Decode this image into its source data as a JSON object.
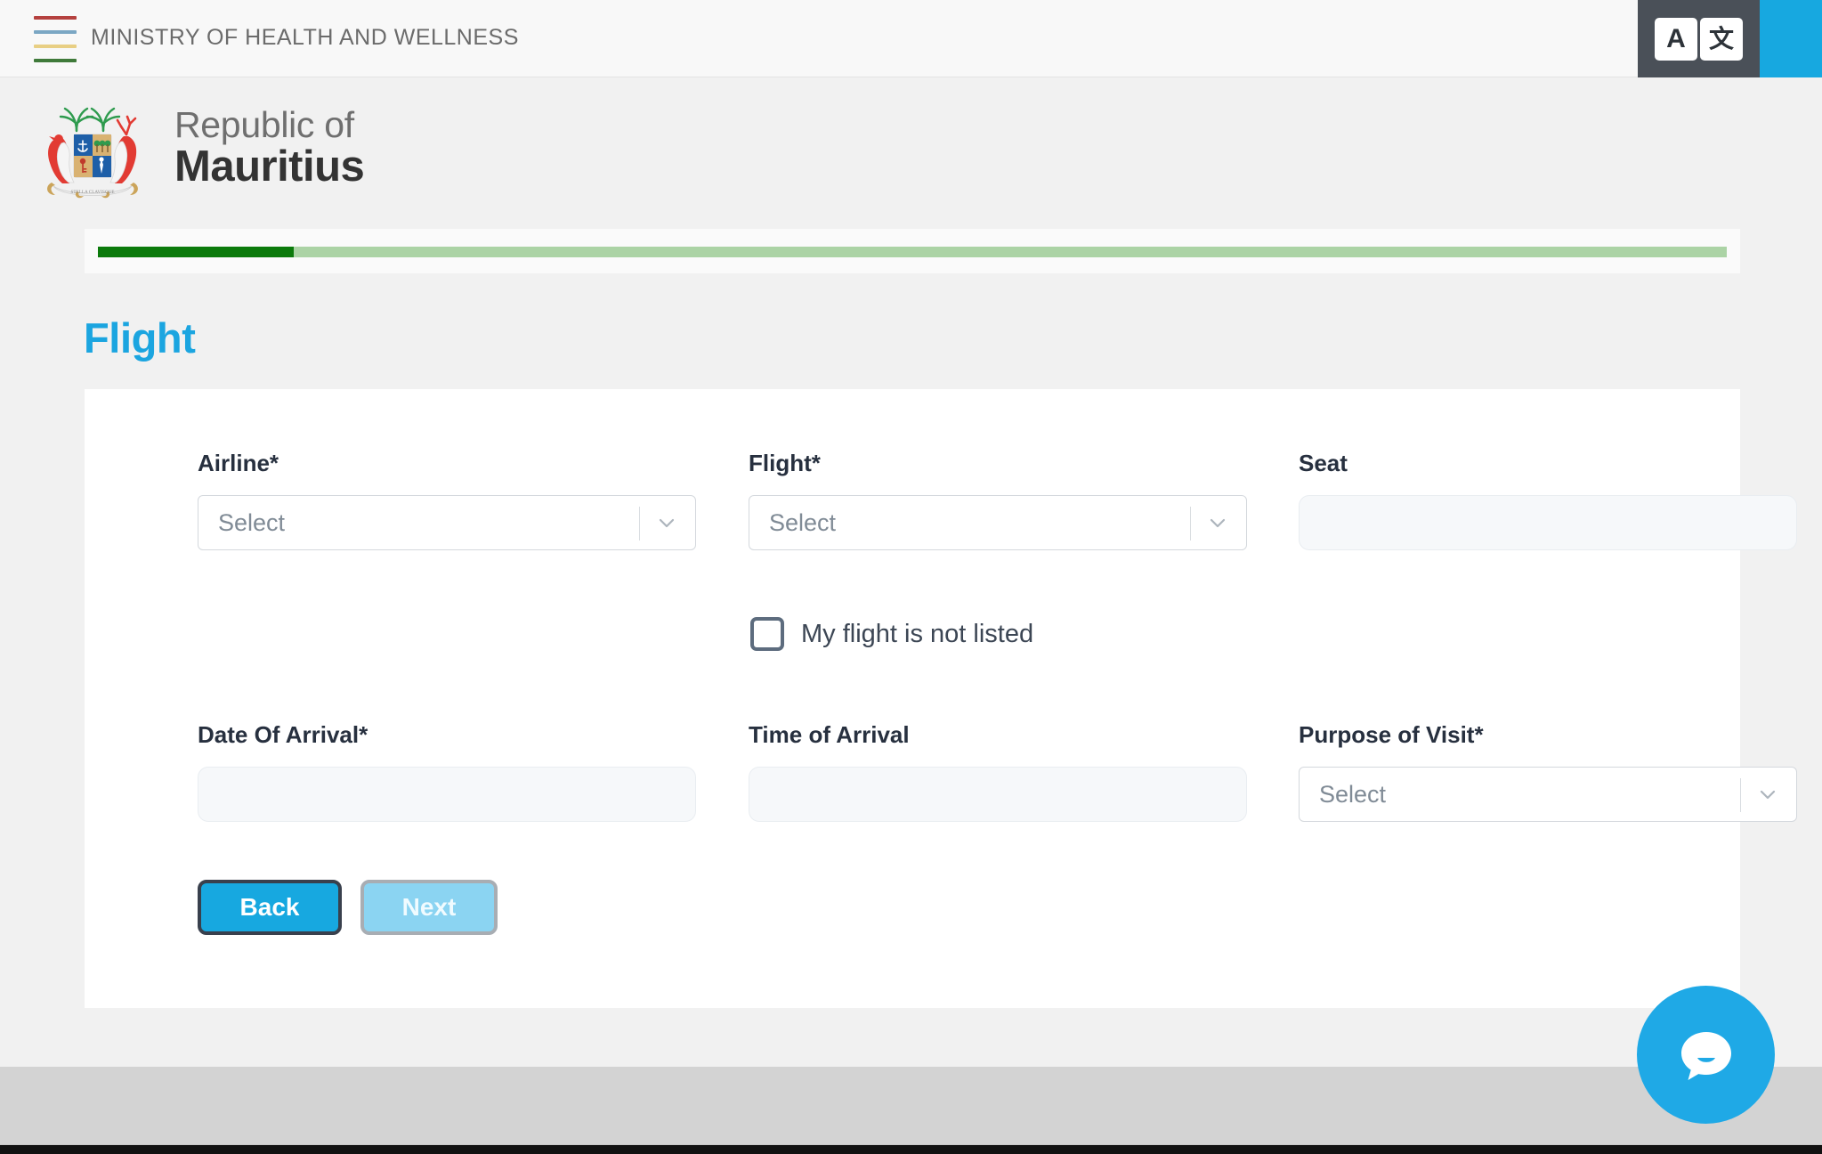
{
  "topbar": {
    "ministry_name": "MINISTRY OF HEALTH AND WELLNESS",
    "flag_icon": "ministry-flag-lines",
    "colors": {
      "red": "#b5413f",
      "blue": "#7ba7c4",
      "yellow": "#e8cf84",
      "green": "#3f7a3a"
    },
    "tools": [
      {
        "icon": "font-size-icon",
        "label": "A"
      },
      {
        "icon": "translate-icon",
        "label": "文"
      }
    ]
  },
  "logo": {
    "crest_icon": "mauritius-coat-of-arms",
    "line1": "Republic of",
    "line2": "Mauritius"
  },
  "progress": {
    "percent": 12,
    "fill_color": "#0b7a0b",
    "track_color": "#abd3a5"
  },
  "page": {
    "section_title": "Flight",
    "title_color": "#1ba5e0"
  },
  "form": {
    "fields": [
      {
        "key": "airline",
        "label": "Airline*",
        "type": "select",
        "value": "",
        "placeholder": "Select"
      },
      {
        "key": "flight",
        "label": "Flight*",
        "type": "select",
        "value": "",
        "placeholder": "Select"
      },
      {
        "key": "seat",
        "label": "Seat",
        "type": "text",
        "value": "",
        "placeholder": ""
      },
      {
        "key": "date_of_arrival",
        "label": "Date Of Arrival*",
        "type": "text",
        "value": "",
        "placeholder": ""
      },
      {
        "key": "time_of_arrival",
        "label": "Time of Arrival",
        "type": "text",
        "value": "",
        "placeholder": ""
      },
      {
        "key": "purpose_of_visit",
        "label": "Purpose of Visit*",
        "type": "select",
        "value": "",
        "placeholder": "Select"
      }
    ],
    "checkbox": {
      "label": "My flight is not listed",
      "checked": false
    },
    "buttons": {
      "back": "Back",
      "next": "Next"
    }
  },
  "chat": {
    "icon": "chat-bubble-icon",
    "color": "#1fa9e6"
  }
}
